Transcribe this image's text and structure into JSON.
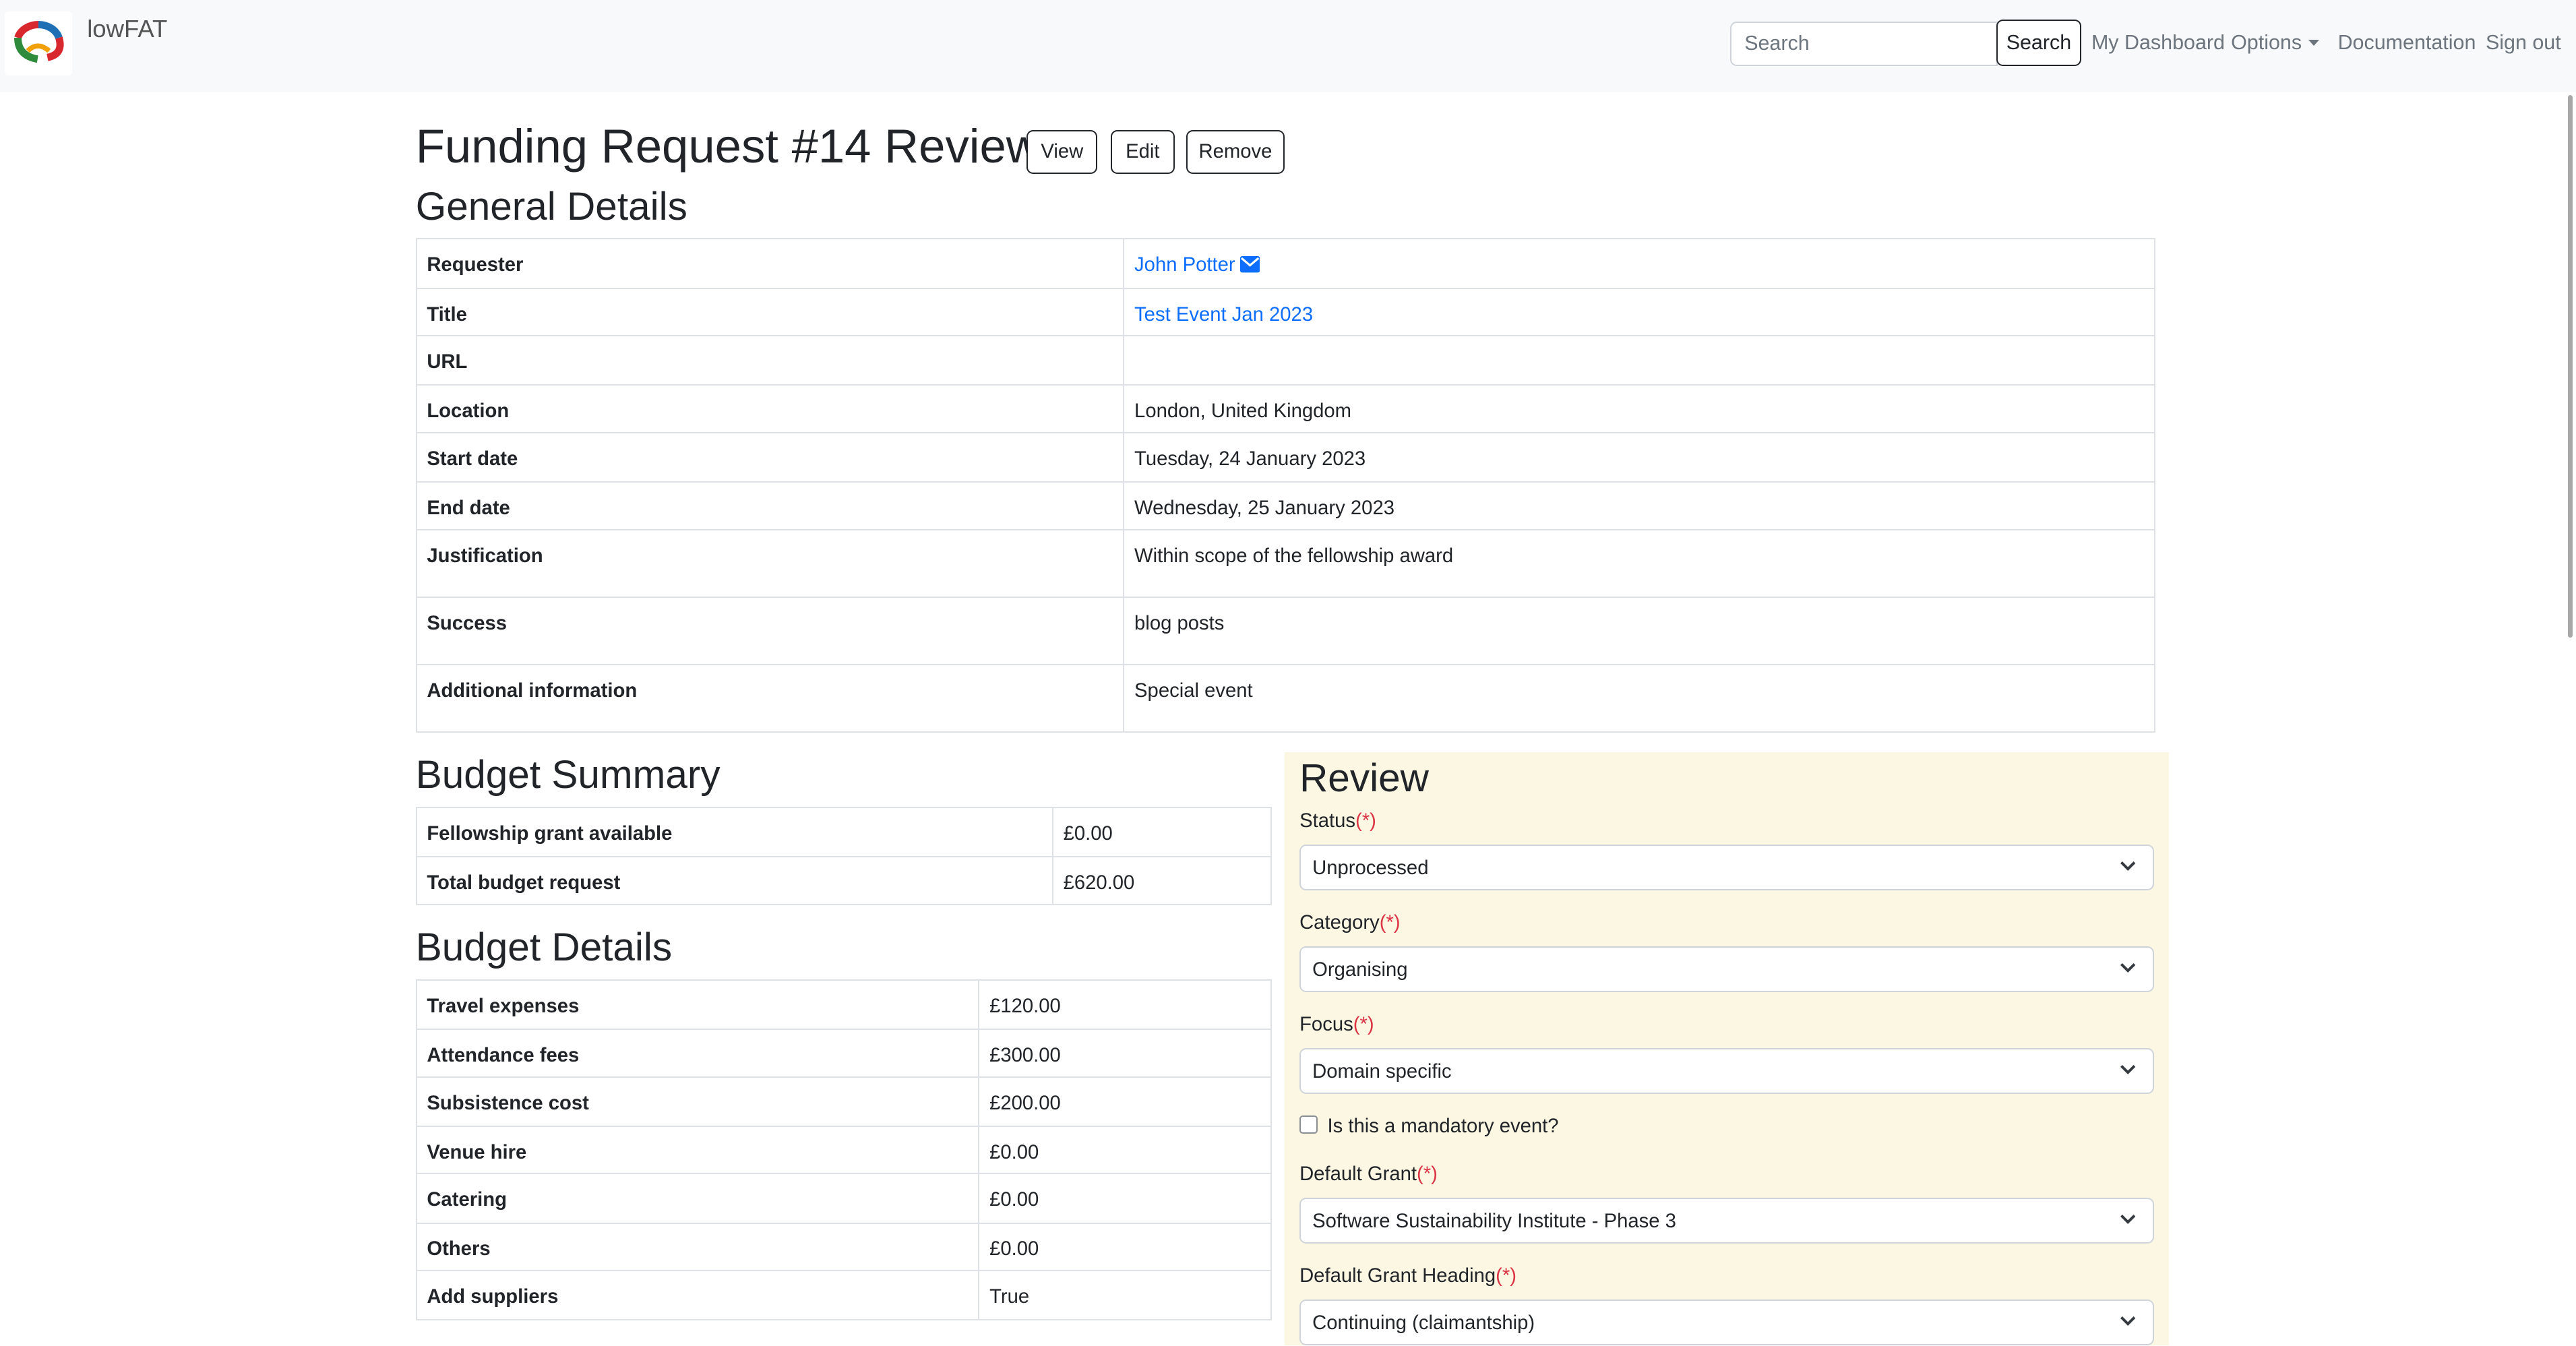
{
  "navbar": {
    "brand": "lowFAT",
    "search_placeholder": "Search",
    "search_button": "Search",
    "links": {
      "dashboard": "My Dashboard",
      "options": "Options",
      "documentation": "Documentation",
      "sign_out": "Sign out"
    }
  },
  "page": {
    "title": "Funding Request #14 Review",
    "buttons": {
      "view": "View",
      "edit": "Edit",
      "remove": "Remove"
    }
  },
  "general": {
    "heading": "General Details",
    "rows": {
      "requester": {
        "label": "Requester",
        "value": "John Potter"
      },
      "title": {
        "label": "Title",
        "value": "Test Event Jan 2023"
      },
      "url": {
        "label": "URL",
        "value": ""
      },
      "location": {
        "label": "Location",
        "value": "London, United Kingdom"
      },
      "start_date": {
        "label": "Start date",
        "value": "Tuesday, 24 January 2023"
      },
      "end_date": {
        "label": "End date",
        "value": "Wednesday, 25 January 2023"
      },
      "justification": {
        "label": "Justification",
        "value": "Within scope of the fellowship award"
      },
      "success": {
        "label": "Success",
        "value": "blog posts"
      },
      "additional": {
        "label": "Additional information",
        "value": "Special event"
      }
    }
  },
  "budget_summary": {
    "heading": "Budget Summary",
    "rows": {
      "grant_available": {
        "label": "Fellowship grant available",
        "value": "£0.00"
      },
      "total_request": {
        "label": "Total budget request",
        "value": "£620.00"
      }
    }
  },
  "budget_details": {
    "heading": "Budget Details",
    "rows": {
      "travel": {
        "label": "Travel expenses",
        "value": "£120.00"
      },
      "attendance": {
        "label": "Attendance fees",
        "value": "£300.00"
      },
      "subsistence": {
        "label": "Subsistence cost",
        "value": "£200.00"
      },
      "venue": {
        "label": "Venue hire",
        "value": "£0.00"
      },
      "catering": {
        "label": "Catering",
        "value": "£0.00"
      },
      "others": {
        "label": "Others",
        "value": "£0.00"
      },
      "suppliers": {
        "label": "Add suppliers",
        "value": "True"
      }
    }
  },
  "review": {
    "heading": "Review",
    "required_marker": "(*)",
    "status": {
      "label": "Status",
      "value": "Unprocessed"
    },
    "category": {
      "label": "Category",
      "value": "Organising"
    },
    "focus": {
      "label": "Focus",
      "value": "Domain specific"
    },
    "mandatory": {
      "label": "Is this a mandatory event?",
      "checked": false
    },
    "default_grant": {
      "label": "Default Grant",
      "value": "Software Sustainability Institute - Phase 3"
    },
    "grant_heading": {
      "label": "Default Grant Heading",
      "value": "Continuing (claimantship)"
    }
  },
  "colors": {
    "link": "#0d6efd",
    "required": "#dc3545",
    "review_background": "#fcf7e3",
    "navbar_background": "#f8f9fa"
  },
  "icons": {
    "logo": "lowfat-logo",
    "mail": "envelope-icon",
    "dropdown": "chevron-down-icon",
    "options_caret": "caret-down-icon"
  }
}
